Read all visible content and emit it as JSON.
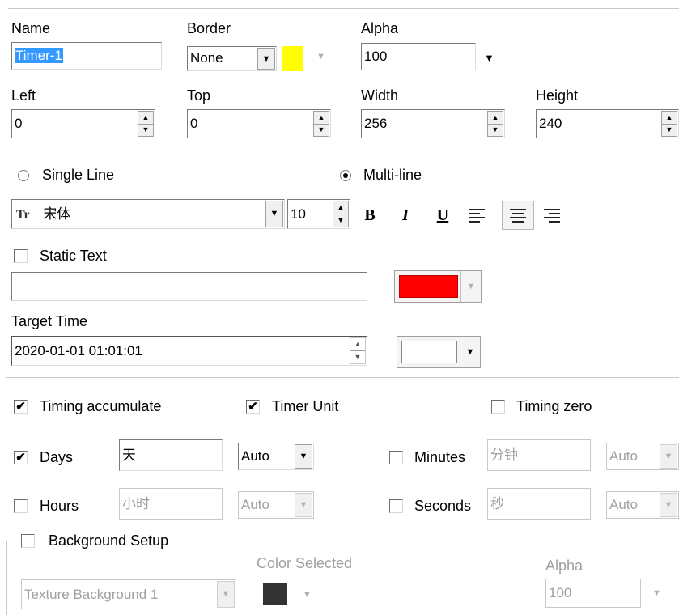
{
  "general": {
    "name_label": "Name",
    "name_value": "Timer-1",
    "border_label": "Border",
    "border_value": "None",
    "border_color": "#ffff00",
    "alpha_label": "Alpha",
    "alpha_value": "100",
    "left_label": "Left",
    "left_value": "0",
    "top_label": "Top",
    "top_value": "0",
    "width_label": "Width",
    "width_value": "256",
    "height_label": "Height",
    "height_value": "240"
  },
  "text": {
    "single_line_label": "Single Line",
    "multi_line_label": "Multi-line",
    "selected_mode": "multi-line",
    "font_icon": "Tr",
    "font_name": "宋体",
    "font_size": "10",
    "bold": "B",
    "italic": "I",
    "underline": "U",
    "static_text_label": "Static Text",
    "static_text_checked": false,
    "static_text_value": "",
    "text_color": "#ff0000",
    "target_time_label": "Target Time",
    "target_time_value": "2020-01-01 01:01:01",
    "target_time_color": "#ffffff"
  },
  "timing": {
    "accumulate_label": "Timing accumulate",
    "accumulate_checked": true,
    "unit_label": "Timer Unit",
    "unit_checked": true,
    "zero_label": "Timing zero",
    "zero_checked": false,
    "days_label": "Days",
    "days_checked": true,
    "days_text": "天",
    "days_mode": "Auto",
    "hours_label": "Hours",
    "hours_checked": false,
    "hours_text": "小时",
    "hours_mode": "Auto",
    "minutes_label": "Minutes",
    "minutes_checked": false,
    "minutes_text": "分钟",
    "minutes_mode": "Auto",
    "seconds_label": "Seconds",
    "seconds_checked": false,
    "seconds_text": "秒",
    "seconds_mode": "Auto"
  },
  "background": {
    "setup_label": "Background Setup",
    "setup_checked": false,
    "color_selected_label": "Color Selected",
    "texture_value": "Texture Background 1",
    "color": "#333333",
    "alpha_label": "Alpha",
    "alpha_value": "100"
  },
  "icons": {
    "checkmark": "✔",
    "spin_up": "▲",
    "spin_down": "▼",
    "dropdown": "▼"
  }
}
